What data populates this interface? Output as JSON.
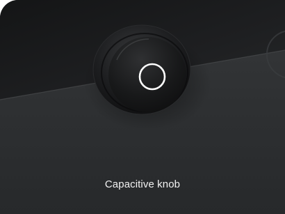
{
  "caption": "Capacitive knob",
  "colors": {
    "upper_panel": "#1c1d1f",
    "lower_panel": "#2e3032",
    "knob_body": "#151516",
    "ring_indicator": "#ffffff",
    "caption_text": "#f2f2f2"
  },
  "icons": {
    "knob_indicator": "ring-icon"
  }
}
